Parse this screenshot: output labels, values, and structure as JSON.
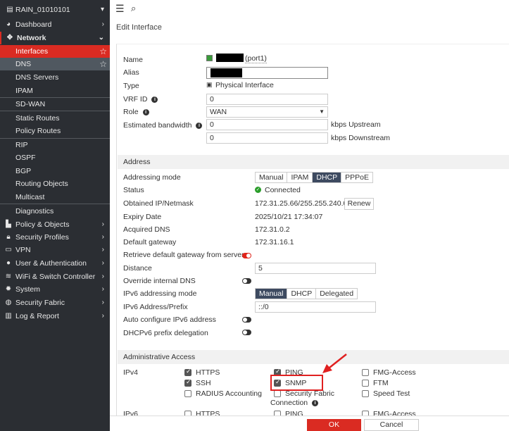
{
  "sidebar": {
    "device": "RAIN_01010101",
    "items": [
      {
        "label": "Dashboard",
        "icon": "dashboard-icon"
      },
      {
        "label": "Network",
        "icon": "network-icon"
      },
      {
        "label": "Interfaces"
      },
      {
        "label": "DNS"
      },
      {
        "label": "DNS Servers"
      },
      {
        "label": "IPAM"
      },
      {
        "label": "SD-WAN"
      },
      {
        "label": "Static Routes"
      },
      {
        "label": "Policy Routes"
      },
      {
        "label": "RIP"
      },
      {
        "label": "OSPF"
      },
      {
        "label": "BGP"
      },
      {
        "label": "Routing Objects"
      },
      {
        "label": "Multicast"
      },
      {
        "label": "Diagnostics"
      },
      {
        "label": "Policy & Objects",
        "icon": "policy-icon"
      },
      {
        "label": "Security Profiles",
        "icon": "lock-icon"
      },
      {
        "label": "VPN",
        "icon": "laptop-icon"
      },
      {
        "label": "User & Authentication",
        "icon": "user-icon"
      },
      {
        "label": "WiFi & Switch Controller",
        "icon": "wifi-icon"
      },
      {
        "label": "System",
        "icon": "gear-icon"
      },
      {
        "label": "Security Fabric",
        "icon": "fabric-icon"
      },
      {
        "label": "Log & Report",
        "icon": "chart-icon"
      }
    ]
  },
  "page": {
    "title": "Edit Interface"
  },
  "form": {
    "name_label": "Name",
    "name_port": "(port1)",
    "alias_label": "Alias",
    "type_label": "Type",
    "type_value": "Physical Interface",
    "vrf_label": "VRF ID",
    "vrf_value": "0",
    "role_label": "Role",
    "role_value": "WAN",
    "bw_label": "Estimated bandwidth",
    "up_value": "0",
    "up_unit": "kbps Upstream",
    "down_value": "0",
    "down_unit": "kbps Downstream"
  },
  "address": {
    "header": "Address",
    "mode_label": "Addressing mode",
    "modes": [
      "Manual",
      "IPAM",
      "DHCP",
      "PPPoE"
    ],
    "status_label": "Status",
    "status_value": "Connected",
    "ip_label": "Obtained IP/Netmask",
    "ip_value": "172.31.25.66/255.255.240.0",
    "renew": "Renew",
    "expiry_label": "Expiry Date",
    "expiry_value": "2025/10/21 17:34:07",
    "dns_label": "Acquired DNS",
    "dns_value": "172.31.0.2",
    "gw_label": "Default gateway",
    "gw_value": "172.31.16.1",
    "retrieve_label": "Retrieve default gateway from server",
    "distance_label": "Distance",
    "distance_value": "5",
    "override_label": "Override internal DNS",
    "ipv6_mode_label": "IPv6 addressing mode",
    "ipv6_modes": [
      "Manual",
      "DHCP",
      "Delegated"
    ],
    "ipv6_prefix_label": "IPv6 Address/Prefix",
    "ipv6_prefix_value": "::/0",
    "autoconf_label": "Auto configure IPv6 address",
    "dhcpv6_label": "DHCPv6 prefix delegation"
  },
  "admin": {
    "header": "Administrative Access",
    "ipv4_label": "IPv4",
    "ipv6_label": "IPv6",
    "ipv4": [
      {
        "label": "HTTPS",
        "checked": true
      },
      {
        "label": "PING",
        "checked": true
      },
      {
        "label": "FMG-Access",
        "checked": false
      },
      {
        "label": "SSH",
        "checked": true
      },
      {
        "label": "SNMP",
        "checked": true
      },
      {
        "label": "FTM",
        "checked": false
      },
      {
        "label": "RADIUS Accounting",
        "checked": false
      },
      {
        "label": "Security Fabric",
        "checked": false
      },
      {
        "label": "Speed Test",
        "checked": false
      }
    ],
    "sf_connection": "Connection",
    "ipv6": [
      {
        "label": "HTTPS"
      },
      {
        "label": "PING"
      },
      {
        "label": "FMG-Access"
      }
    ]
  },
  "footer": {
    "ok": "OK",
    "cancel": "Cancel"
  },
  "colors": {
    "accent": "#da2b22",
    "sidebar": "#2b2e33",
    "selected": "#3d4a60"
  }
}
